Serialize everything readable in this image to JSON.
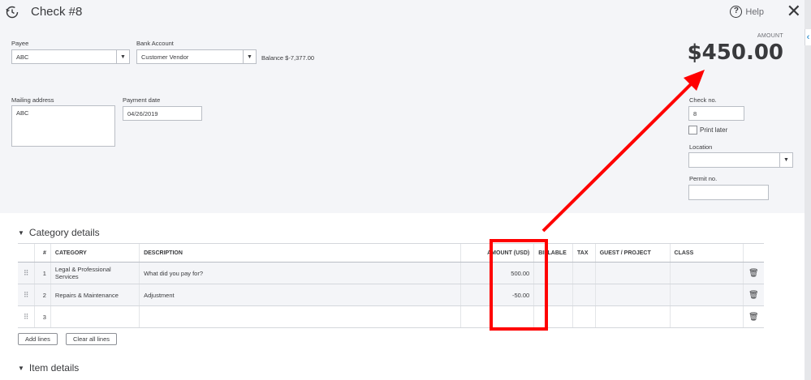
{
  "header": {
    "title": "Check #8",
    "help_label": "Help"
  },
  "payee": {
    "label": "Payee",
    "value": "ABC"
  },
  "bank_account": {
    "label": "Bank Account",
    "value": "Customer Vendor",
    "balance": "Balance $-7,377.00"
  },
  "amount": {
    "label": "AMOUNT",
    "value": "$450.00"
  },
  "mailing_address": {
    "label": "Mailing address",
    "value": "ABC"
  },
  "payment_date": {
    "label": "Payment date",
    "value": "04/26/2019"
  },
  "check_no": {
    "label": "Check no.",
    "value": "8"
  },
  "print_later": {
    "label": "Print later",
    "checked": false
  },
  "location": {
    "label": "Location",
    "value": ""
  },
  "permit_no": {
    "label": "Permit no.",
    "value": ""
  },
  "category_details": {
    "heading": "Category details",
    "columns": [
      "#",
      "CATEGORY",
      "DESCRIPTION",
      "AMOUNT (USD)",
      "BILLABLE",
      "TAX",
      "GUEST / PROJECT",
      "CLASS"
    ],
    "rows": [
      {
        "num": "1",
        "category": "Legal & Professional Services",
        "description": "",
        "description_placeholder": "What did you pay for?",
        "amount": "500.00"
      },
      {
        "num": "2",
        "category": "Repairs & Maintenance",
        "description": "Adjustment",
        "description_placeholder": "",
        "amount": "-50.00"
      },
      {
        "num": "3",
        "category": "",
        "description": "",
        "description_placeholder": "",
        "amount": ""
      }
    ],
    "add_lines_label": "Add lines",
    "clear_lines_label": "Clear all lines"
  },
  "item_details": {
    "heading": "Item details"
  },
  "annotation": {
    "highlight_color": "#ff0000"
  },
  "icons": {
    "title": "history-clock-icon",
    "help": "help-circle-icon",
    "close": "close-icon",
    "grip": "drag-handle-icon",
    "trash": "trash-icon"
  }
}
